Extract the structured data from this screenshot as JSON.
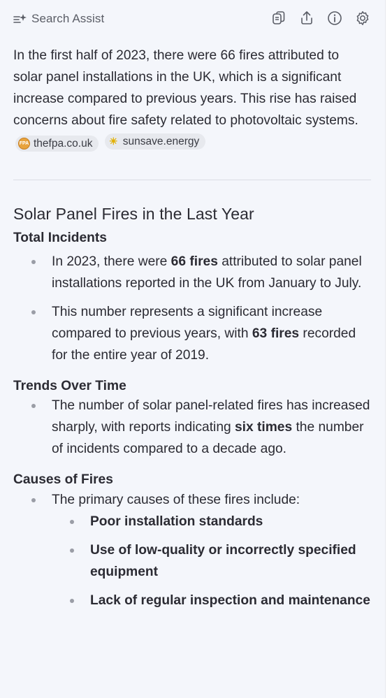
{
  "header": {
    "title": "Search Assist",
    "tools": [
      "copy-icon",
      "share-icon",
      "info-icon",
      "settings-icon"
    ]
  },
  "intro": {
    "text": "In the first half of 2023, there were 66 fires attributed to solar panel installations in the UK, which is a significant increase compared to previous years. This rise has raised concerns about fire safety related to photovoltaic systems.",
    "sources": [
      {
        "label": "thefpa.co.uk",
        "badge": "FPA"
      },
      {
        "label": "sunsave.energy",
        "badge": "☀"
      }
    ]
  },
  "section": {
    "heading": "Solar Panel Fires in the Last Year",
    "total": {
      "heading": "Total Incidents",
      "b1_pre": "In 2023, there were ",
      "b1_bold": "66 fires",
      "b1_post": " attributed to solar panel installations reported in the UK from January to July.",
      "b2_pre": "This number represents a significant increase compared to previous years, with ",
      "b2_bold": "63 fires",
      "b2_post": " recorded for the entire year of 2019."
    },
    "trends": {
      "heading": "Trends Over Time",
      "b1_pre": "The number of solar panel-related fires has increased sharply, with reports indicating ",
      "b1_bold": "six times",
      "b1_post": " the number of incidents compared to a decade ago."
    },
    "causes": {
      "heading": "Causes of Fires",
      "lead": "The primary causes of these fires include:",
      "items": [
        "Poor installation standards",
        "Use of low-quality or incorrectly specified equipment",
        "Lack of regular inspection and maintenance"
      ]
    }
  },
  "colors": {
    "panel_bg": "#f4f6fb",
    "text": "#2b2b33",
    "chip_bg": "#e7e9ee"
  }
}
